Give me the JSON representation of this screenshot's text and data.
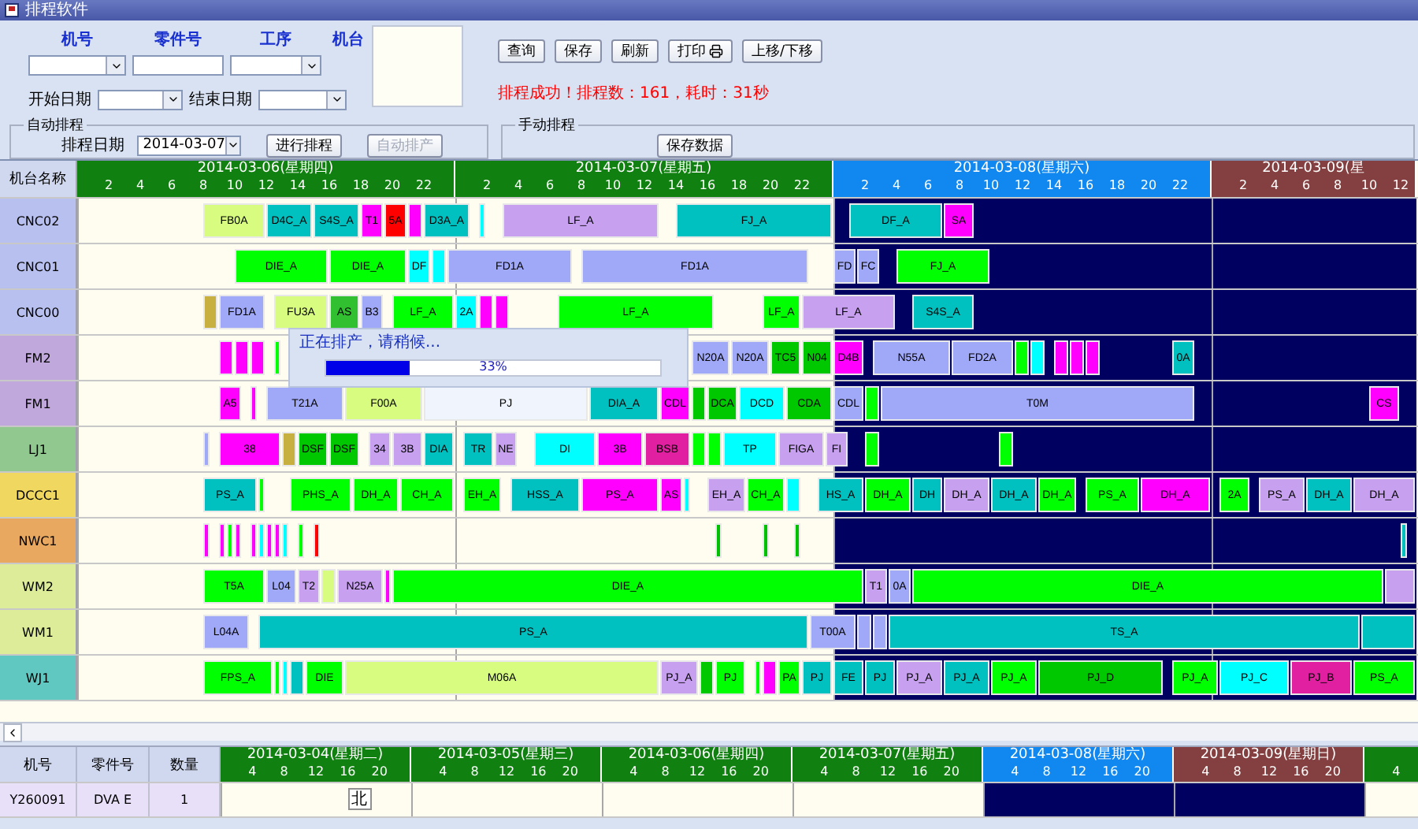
{
  "window": {
    "title": "排程软件"
  },
  "filters": {
    "machine_no": {
      "label": "机号"
    },
    "part_no": {
      "label": "零件号"
    },
    "process": {
      "label": "工序"
    },
    "machine": {
      "label": "机台"
    },
    "start_date": {
      "label": "开始日期"
    },
    "end_date": {
      "label": "结束日期"
    }
  },
  "buttons": [
    {
      "label": "查询",
      "kind": "plain"
    },
    {
      "label": "保存",
      "kind": "plain"
    },
    {
      "label": "刷新",
      "kind": "plain"
    },
    {
      "label": "打印",
      "kind": "print"
    },
    {
      "label": "上移/下移",
      "kind": "plain"
    }
  ],
  "status_message": "排程成功！排程数：161，耗时：31秒",
  "auto_schedule": {
    "title": "自动排程",
    "date_label": "排程日期",
    "date_value": "2014-03-07",
    "buttons": [
      {
        "label": "进行排程",
        "disabled": false
      },
      {
        "label": "自动排产",
        "disabled": true
      }
    ]
  },
  "manual_schedule": {
    "title": "手动排程",
    "button": "保存数据"
  },
  "gantt": {
    "corner": "机台名称",
    "days": [
      {
        "label": "2014-03-06(星期四)",
        "kind": "weekday",
        "off": false,
        "ticks": [
          "2",
          "4",
          "6",
          "8",
          "10",
          "12",
          "14",
          "16",
          "18",
          "20",
          "22"
        ]
      },
      {
        "label": "2014-03-07(星期五)",
        "kind": "weekday",
        "off": false,
        "ticks": [
          "2",
          "4",
          "6",
          "8",
          "10",
          "12",
          "14",
          "16",
          "18",
          "20",
          "22"
        ]
      },
      {
        "label": "2014-03-08(星期六)",
        "kind": "saturday",
        "off": true,
        "ticks": [
          "2",
          "4",
          "6",
          "8",
          "10",
          "12",
          "14",
          "16",
          "18",
          "20",
          "22"
        ]
      },
      {
        "label": "2014-03-09(星",
        "kind": "sunday",
        "off": true,
        "ticks": [
          "2",
          "4",
          "6",
          "8",
          "10",
          "12"
        ]
      }
    ],
    "rows": [
      {
        "name": "CNC02",
        "color": "#b8c0f0",
        "bars": [
          {
            "label": "FB0A",
            "color": "#d8fc80"
          },
          {
            "label": "D4C_A",
            "color": "#00c0c0"
          },
          {
            "label": "S4S_A",
            "color": "#00c0c0"
          },
          {
            "label": "T1",
            "color": "#ff00ff"
          },
          {
            "label": "5A",
            "color": "#ff0000"
          },
          {
            "color": "#ff00ff"
          },
          {
            "label": "D3A_A",
            "color": "#00c0c0"
          },
          {
            "color": "#00ffff"
          },
          {
            "label": "LF_A",
            "color": "#c8a0f0"
          },
          {
            "label": "FJ_A",
            "color": "#00c0c0"
          },
          {
            "label": "DF_A",
            "color": "#00c0c0"
          },
          {
            "label": "SA",
            "color": "#ff00ff"
          }
        ]
      },
      {
        "name": "CNC01",
        "color": "#b8c0f0",
        "bars": [
          {
            "label": "DIE_A",
            "color": "#00ff00"
          },
          {
            "label": "DIE_A",
            "color": "#00ff00"
          },
          {
            "label": "DF",
            "color": "#00ffff"
          },
          {
            "color": "#00ffff"
          },
          {
            "label": "FD1A",
            "color": "#a0a8f8"
          },
          {
            "label": "FD1A",
            "color": "#a0a8f8"
          },
          {
            "label": "FD",
            "color": "#a0a8f8"
          },
          {
            "label": "FC",
            "color": "#a0a8f8"
          },
          {
            "label": "FJ_A",
            "color": "#00ff00"
          }
        ]
      },
      {
        "name": "CNC00",
        "color": "#b8c0f0",
        "bars": [
          {
            "color": "#c8b040"
          },
          {
            "label": "FD1A",
            "color": "#a0a8f8"
          },
          {
            "label": "FU3A",
            "color": "#d8fc80"
          },
          {
            "label": "AS",
            "color": "#30c030"
          },
          {
            "label": "B3",
            "color": "#a0a8f8"
          },
          {
            "label": "LF_A",
            "color": "#00ff00"
          },
          {
            "label": "2A",
            "color": "#00ffff"
          },
          {
            "color": "#ff00ff"
          },
          {
            "color": "#ff00ff"
          },
          {
            "label": "LF_A",
            "color": "#00ff00"
          },
          {
            "label": "LF_A",
            "color": "#00ff00"
          },
          {
            "label": "LF_A",
            "color": "#c8a0f0"
          },
          {
            "label": "S4S_A",
            "color": "#00c0c0"
          }
        ]
      },
      {
        "name": "FM2",
        "color": "#c0a8dc",
        "bars": [
          {
            "color": "#ff00ff"
          },
          {
            "color": "#ff00ff"
          },
          {
            "color": "#ff00ff"
          },
          {
            "color": "#00ff00"
          },
          {
            "label": "N20A",
            "color": "#a0a8f8"
          },
          {
            "label": "N20A",
            "color": "#a0a8f8"
          },
          {
            "label": "TC5",
            "color": "#00c800"
          },
          {
            "label": "N04",
            "color": "#00c800"
          },
          {
            "label": "D4B",
            "color": "#ff00ff"
          },
          {
            "label": "N55A",
            "color": "#a0a8f8"
          },
          {
            "label": "FD2A",
            "color": "#a0a8f8"
          },
          {
            "color": "#00ff00"
          },
          {
            "color": "#00ffff"
          },
          {
            "color": "#ff00ff"
          },
          {
            "color": "#ff00ff"
          },
          {
            "color": "#ff00ff"
          },
          {
            "label": "0A",
            "color": "#00c0c0"
          }
        ]
      },
      {
        "name": "FM1",
        "color": "#c0a8dc",
        "bars": [
          {
            "label": "A5",
            "color": "#ff00ff"
          },
          {
            "color": "#ff00ff"
          },
          {
            "label": "T21A",
            "color": "#a0a8f8"
          },
          {
            "label": "F00A",
            "color": "#d8fc80"
          },
          {
            "label": "PJ",
            "color": "#f0f4fc"
          },
          {
            "label": "DIA_A",
            "color": "#00c0c0"
          },
          {
            "label": "CDL",
            "color": "#ff00ff"
          },
          {
            "color": "#00c800"
          },
          {
            "label": "DCA",
            "color": "#00c800"
          },
          {
            "label": "DCD",
            "color": "#00ffff"
          },
          {
            "label": "CDA",
            "color": "#00c800"
          },
          {
            "label": "CDL",
            "color": "#a0a8f8"
          },
          {
            "color": "#00ff00"
          },
          {
            "label": "T0M",
            "color": "#a0a8f8"
          },
          {
            "label": "CS",
            "color": "#ff00ff"
          }
        ]
      },
      {
        "name": "LJ1",
        "color": "#90c890",
        "bars": [
          {
            "color": "#a0a8f8"
          },
          {
            "label": "38",
            "color": "#ff00ff"
          },
          {
            "color": "#c8b040"
          },
          {
            "label": "DSF",
            "color": "#00c800"
          },
          {
            "label": "DSF",
            "color": "#00c800"
          },
          {
            "label": "34",
            "color": "#c8a0f0"
          },
          {
            "label": "3B",
            "color": "#c8a0f0"
          },
          {
            "label": "DIA",
            "color": "#00c0c0"
          },
          {
            "label": "TR",
            "color": "#00c0c0"
          },
          {
            "label": "NE",
            "color": "#c8a0f0"
          },
          {
            "label": "DI",
            "color": "#00ffff"
          },
          {
            "label": "3B",
            "color": "#ff00ff"
          },
          {
            "label": "BSB",
            "color": "#e020a0"
          },
          {
            "color": "#00ff00"
          },
          {
            "color": "#00ff00"
          },
          {
            "label": "TP",
            "color": "#00ffff"
          },
          {
            "label": "FIGA",
            "color": "#c8a0f0"
          },
          {
            "label": "FI",
            "color": "#c8a0f0"
          },
          {
            "color": "#00ff00"
          },
          {
            "color": "#00ff00"
          }
        ]
      },
      {
        "name": "DCCC1",
        "color": "#f0d860",
        "bars": [
          {
            "label": "PS_A",
            "color": "#00c0c0"
          },
          {
            "color": "#00ff00"
          },
          {
            "label": "PHS_A",
            "color": "#00ff00"
          },
          {
            "label": "DH_A",
            "color": "#00ff00"
          },
          {
            "label": "CH_A",
            "color": "#00ff00"
          },
          {
            "label": "EH_A",
            "color": "#00ff00"
          },
          {
            "label": "HSS_A",
            "color": "#00c0c0"
          },
          {
            "label": "PS_A",
            "color": "#ff00ff"
          },
          {
            "label": "AS",
            "color": "#ff00ff"
          },
          {
            "color": "#00ffff"
          },
          {
            "label": "EH_A",
            "color": "#c8a0f0"
          },
          {
            "label": "CH_A",
            "color": "#00ff00"
          },
          {
            "color": "#00ffff"
          },
          {
            "label": "HS_A",
            "color": "#00c0c0"
          },
          {
            "label": "DH_A",
            "color": "#00ff00"
          },
          {
            "label": "DH",
            "color": "#00c0c0"
          },
          {
            "label": "DH_A",
            "color": "#c8a0f0"
          },
          {
            "label": "DH_A",
            "color": "#00c0c0"
          },
          {
            "label": "DH_A",
            "color": "#00ff00"
          },
          {
            "label": "PS_A",
            "color": "#00ff00"
          },
          {
            "label": "DH_A",
            "color": "#ff00ff"
          },
          {
            "label": "2A",
            "color": "#00ff00"
          },
          {
            "label": "PS_A",
            "color": "#c8a0f0"
          },
          {
            "label": "DH_A",
            "color": "#00c0c0"
          },
          {
            "label": "DH_A",
            "color": "#c8a0f0"
          }
        ]
      },
      {
        "name": "NWC1",
        "color": "#e8a860",
        "bars": [
          {
            "color": "#ff00ff"
          },
          {
            "color": "#ff00ff"
          },
          {
            "color": "#00ff00"
          },
          {
            "color": "#ff00ff"
          },
          {
            "color": "#ff00ff"
          },
          {
            "color": "#00ffff"
          },
          {
            "color": "#ff00ff"
          },
          {
            "color": "#ff00ff"
          },
          {
            "color": "#00ffff"
          },
          {
            "color": "#00ff00"
          },
          {
            "color": "#ff0000"
          },
          {
            "color": "#00c000"
          },
          {
            "color": "#00c000"
          },
          {
            "color": "#00c000"
          },
          {
            "color": "#00c0c0"
          }
        ]
      },
      {
        "name": "WM2",
        "color": "#dcec98",
        "bars": [
          {
            "label": "T5A",
            "color": "#00ff00"
          },
          {
            "label": "L04",
            "color": "#a0a8f8"
          },
          {
            "label": "T2",
            "color": "#c8a0f0"
          },
          {
            "color": "#d8fc80"
          },
          {
            "label": "N25A",
            "color": "#c8a0f0"
          },
          {
            "color": "#ff00ff"
          },
          {
            "label": "DIE_A",
            "color": "#00ff00"
          },
          {
            "label": "T1",
            "color": "#c8a0f0"
          },
          {
            "label": "0A",
            "color": "#a0a8f8"
          },
          {
            "label": "DIE_A",
            "color": "#00ff00"
          },
          {
            "color": "#c8a0f0"
          }
        ]
      },
      {
        "name": "WM1",
        "color": "#dcec98",
        "bars": [
          {
            "label": "L04A",
            "color": "#a0a8f8"
          },
          {
            "label": "PS_A",
            "color": "#00c0c0"
          },
          {
            "label": "T00A",
            "color": "#a0a8f8"
          },
          {
            "color": "#a0a8f8"
          },
          {
            "color": "#a0a8f8"
          },
          {
            "label": "TS_A",
            "color": "#00c0c0"
          },
          {
            "color": "#00c0c0"
          }
        ]
      },
      {
        "name": "WJ1",
        "color": "#60c8c0",
        "bars": [
          {
            "label": "FPS_A",
            "color": "#00ff00"
          },
          {
            "color": "#00ff00"
          },
          {
            "color": "#00ffff"
          },
          {
            "color": "#00c0c0"
          },
          {
            "label": "DIE",
            "color": "#00ff00"
          },
          {
            "label": "M06A",
            "color": "#d8fc80"
          },
          {
            "label": "PJ_A",
            "color": "#c8a0f0"
          },
          {
            "color": "#00c800"
          },
          {
            "label": "PJ",
            "color": "#00ff00"
          },
          {
            "color": "#00ff00"
          },
          {
            "color": "#ff00ff"
          },
          {
            "label": "PA",
            "color": "#00ff00"
          },
          {
            "label": "PJ",
            "color": "#00c0c0"
          },
          {
            "label": "FE",
            "color": "#00c0c0"
          },
          {
            "label": "PJ",
            "color": "#00c0c0"
          },
          {
            "label": "PJ_A",
            "color": "#c8a0f0"
          },
          {
            "label": "PJ_A",
            "color": "#00c0c0"
          },
          {
            "label": "PJ_A",
            "color": "#00ff00"
          },
          {
            "label": "PJ_D",
            "color": "#00c800"
          },
          {
            "label": "PJ_A",
            "color": "#00ff00"
          },
          {
            "label": "PJ_C",
            "color": "#00ffff"
          },
          {
            "label": "PJ_B",
            "color": "#e020a0"
          },
          {
            "label": "PS_A",
            "color": "#00ff00"
          }
        ]
      }
    ]
  },
  "progress": {
    "message": "正在排产，请稍候...",
    "level": 0.25,
    "reading": "33%"
  },
  "detail": {
    "columns": [
      "机号",
      "零件号",
      "数量"
    ],
    "rows": [
      {
        "cells": [
          "Y260091",
          "DVA E",
          "1"
        ]
      }
    ],
    "days": [
      {
        "label": "2014-03-04(星期二)",
        "kind": "weekday",
        "off": false,
        "ticks": [
          "4",
          "8",
          "12",
          "16",
          "20"
        ]
      },
      {
        "label": "2014-03-05(星期三)",
        "kind": "weekday",
        "off": false,
        "ticks": [
          "4",
          "8",
          "12",
          "16",
          "20"
        ]
      },
      {
        "label": "2014-03-06(星期四)",
        "kind": "weekday",
        "off": false,
        "ticks": [
          "4",
          "8",
          "12",
          "16",
          "20"
        ]
      },
      {
        "label": "2014-03-07(星期五)",
        "kind": "weekday",
        "off": false,
        "ticks": [
          "4",
          "8",
          "12",
          "16",
          "20"
        ]
      },
      {
        "label": "2014-03-08(星期六)",
        "kind": "saturday",
        "off": true,
        "ticks": [
          "4",
          "8",
          "12",
          "16",
          "20"
        ]
      },
      {
        "label": "2014-03-09(星期日)",
        "kind": "sunday",
        "off": true,
        "ticks": [
          "4",
          "8",
          "12",
          "16",
          "20"
        ]
      },
      {
        "kind": "weekday",
        "off": false,
        "ticks": [
          "4"
        ]
      }
    ],
    "marks": [
      {
        "label": "北"
      }
    ]
  }
}
